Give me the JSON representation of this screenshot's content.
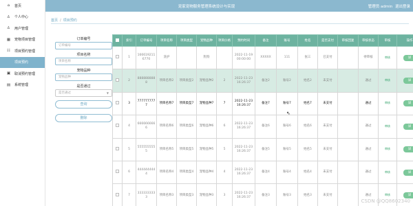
{
  "header": {
    "title": "宠家宠物服务管理系统设计与实现",
    "role": "管理员 admin",
    "logout": "退出登录"
  },
  "sidebar": {
    "items": [
      {
        "icon": "⌂",
        "label": "首页"
      },
      {
        "icon": "♙",
        "label": "个人中心"
      },
      {
        "icon": "♙",
        "label": "用户管理"
      },
      {
        "icon": "▦",
        "label": "宠物项目管理"
      },
      {
        "icon": "☷",
        "label": "项目预约管理"
      },
      {
        "icon": "",
        "label": "项目预约"
      },
      {
        "icon": "▣",
        "label": "取消预约管理"
      },
      {
        "icon": "▤",
        "label": "系统管理"
      }
    ]
  },
  "breadcrumb": {
    "home": "首页",
    "sep": "/",
    "current": "项目预约"
  },
  "filter": {
    "order_label": "订单编号",
    "order_placeholder": "订单编号",
    "name_label": "项目名称",
    "name_placeholder": "项目名称",
    "breed_label": "宠物品种",
    "breed_placeholder": "宠物品种",
    "passed_label": "是否通过",
    "passed_placeholder": "是否通过",
    "search_button": "查询",
    "delete_button": "删除"
  },
  "table": {
    "headers": [
      "",
      "索引",
      "订单编号",
      "项目名称",
      "项目类型",
      "宠物品种",
      "项目价格",
      "预约时间",
      "备注",
      "账号",
      "姓名",
      "是否支付",
      "审核回复",
      "审核状态",
      "审核",
      "操作"
    ],
    "rows": [
      {
        "index": "1",
        "order": "1666192116770",
        "name": "洗护",
        "type": "",
        "breed": "狗狗",
        "price": "",
        "time": "2022-11-19 00:00:00",
        "remark": "XXXXX",
        "account": "111",
        "person": "张三",
        "paid": "已支付",
        "reply": "",
        "status": "待审核",
        "audit": "审核",
        "op": "详"
      },
      {
        "index": "2",
        "order": "8888888888",
        "name": "项目名称2",
        "type": "项目类型2",
        "breed": "宠物品种2",
        "price": "2",
        "time": "2022-11-23 16:26:37",
        "remark": "备注2",
        "account": "账号2",
        "person": "姓名2",
        "paid": "未支付",
        "reply": "",
        "status": "通过",
        "audit": "审核",
        "op": "详"
      },
      {
        "index": "3",
        "order": "7777777777",
        "name": "项目名称7",
        "type": "项目类型7",
        "breed": "宠物品种7",
        "price": "7",
        "time": "2022-11-23 16:26:37",
        "remark": "备注7",
        "account": "账号7",
        "person": "姓名7",
        "paid": "未支付",
        "reply": "",
        "status": "通过",
        "audit": "审核",
        "op": "详"
      },
      {
        "index": "4",
        "order": "6666666666",
        "name": "项目名称6",
        "type": "项目类型6",
        "breed": "宠物品种6",
        "price": "6",
        "time": "2022-11-23 16:26:37",
        "remark": "备注6",
        "account": "账号6",
        "person": "姓名6",
        "paid": "未支付",
        "reply": "",
        "status": "通过",
        "audit": "审核",
        "op": "详"
      },
      {
        "index": "5",
        "order": "5555555555",
        "name": "项目名称5",
        "type": "项目类型5",
        "breed": "宠物品种5",
        "price": "5",
        "time": "2022-11-23 16:26:37",
        "remark": "备注5",
        "account": "账号5",
        "person": "姓名5",
        "paid": "未支付",
        "reply": "",
        "status": "通过",
        "audit": "审核",
        "op": "详"
      },
      {
        "index": "6",
        "order": "4444444444",
        "name": "项目名称4",
        "type": "项目类型4",
        "breed": "宠物品种4",
        "price": "4",
        "time": "2022-11-23 16:26:37",
        "remark": "备注4",
        "account": "账号4",
        "person": "姓名4",
        "paid": "未支付",
        "reply": "",
        "status": "通过",
        "audit": "审核",
        "op": "详"
      },
      {
        "index": "7",
        "order": "3333333333",
        "name": "项目名称3",
        "type": "项目类型3",
        "breed": "宠物品种3",
        "price": "3",
        "time": "2022-11-23 16:26:37",
        "remark": "备注3",
        "account": "账号3",
        "person": "姓名3",
        "paid": "未支付",
        "reply": "",
        "status": "通过",
        "audit": "审核",
        "op": "详"
      }
    ]
  },
  "watermark": "CSDN @QQ8602340",
  "colors": {
    "accent": "#7fb3cc",
    "table_header": "#6db3a0",
    "highlight_row": "#d7ebe3",
    "action_green": "#7cc89a"
  }
}
